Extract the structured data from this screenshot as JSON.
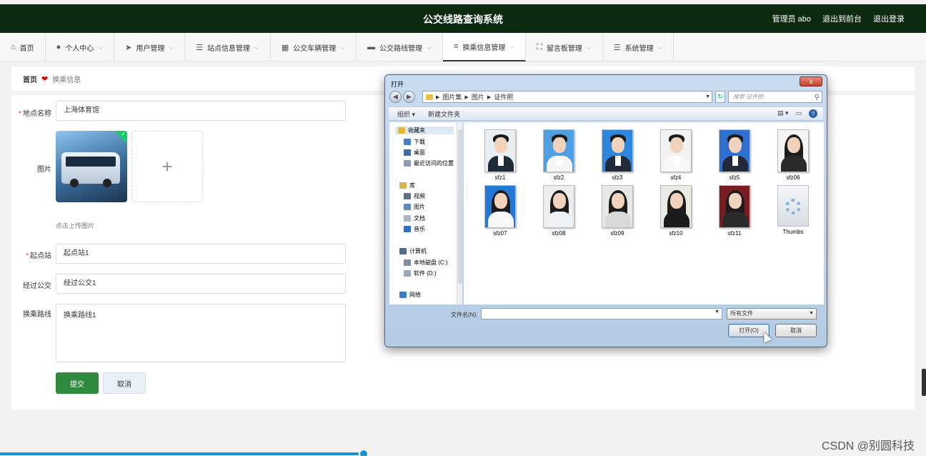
{
  "header": {
    "title": "公交线路查询系统",
    "user_label": "管理员 abo",
    "front_link": "退出到前台",
    "logout_link": "退出登录",
    "bg_color": "#0b2a10"
  },
  "nav": [
    {
      "label": "首页",
      "icon": "home-icon",
      "glyph": "⌂",
      "chev": ""
    },
    {
      "label": "个人中心",
      "icon": "user-icon",
      "glyph": "●",
      "chev": "⌵"
    },
    {
      "label": "用户管理",
      "icon": "send-icon",
      "glyph": "➤",
      "chev": "⌵"
    },
    {
      "label": "站点信息管理",
      "icon": "list-icon",
      "glyph": "☰",
      "chev": "⌵"
    },
    {
      "label": "公交车辆管理",
      "icon": "grid-icon",
      "glyph": "▦",
      "chev": "⌵"
    },
    {
      "label": "公交路线管理",
      "icon": "monitor-icon",
      "glyph": "▬",
      "chev": "⌵"
    },
    {
      "label": "换乘信息管理",
      "icon": "sliders-icon",
      "glyph": "≡",
      "chev": "⌵",
      "active": true
    },
    {
      "label": "留言板管理",
      "icon": "expand-icon",
      "glyph": "⛶",
      "chev": "⌵"
    },
    {
      "label": "系统管理",
      "icon": "menu-icon",
      "glyph": "☰",
      "chev": "⌵"
    }
  ],
  "breadcrumb": {
    "home": "首页",
    "current": "换乘信息"
  },
  "form": {
    "location_label": "地点名称",
    "location_value": "上海体育馆",
    "image_label": "图片",
    "upload_hint": "点击上传图片",
    "start_label": "起点站",
    "start_value": "起点站1",
    "bus_label": "经过公交",
    "bus_value": "经过公交1",
    "route_label": "换乘路线",
    "route_value": "换乘路线1",
    "submit": "提交",
    "cancel": "取消",
    "submit_color": "#2e8b3e"
  },
  "dialog": {
    "title": "打开",
    "close": "x",
    "path": [
      "图片集",
      "图片",
      "证件照"
    ],
    "search_placeholder": "搜索 证件照",
    "toolbar": {
      "organize": "组织 ▾",
      "new_folder": "新建文件夹"
    },
    "tree": [
      {
        "label": "收藏夹",
        "icon": "star-icon",
        "color": "#e8b839",
        "sub": false,
        "hl": true
      },
      {
        "label": "下载",
        "icon": "download-icon",
        "color": "#4a7fc1",
        "sub": true
      },
      {
        "label": "桌面",
        "icon": "desktop-icon",
        "color": "#3a6db0",
        "sub": true
      },
      {
        "label": "最近访问的位置",
        "icon": "recent-icon",
        "color": "#8a9db3",
        "sub": true
      },
      {
        "label": "库",
        "icon": "library-icon",
        "color": "#d8b24a",
        "sub": false
      },
      {
        "label": "视频",
        "icon": "video-icon",
        "color": "#5b6f86",
        "sub": true
      },
      {
        "label": "图片",
        "icon": "picture-icon",
        "color": "#5a8ac0",
        "sub": true
      },
      {
        "label": "文档",
        "icon": "document-icon",
        "color": "#a8b6c6",
        "sub": true
      },
      {
        "label": "音乐",
        "icon": "music-icon",
        "color": "#2f6fc4",
        "sub": true
      },
      {
        "label": "计算机",
        "icon": "computer-icon",
        "color": "#4f6c8e",
        "sub": false
      },
      {
        "label": "本地磁盘 (C:)",
        "icon": "disk-icon",
        "color": "#7d8fa3",
        "sub": true
      },
      {
        "label": "软件 (D:)",
        "icon": "disk-icon",
        "color": "#9aa8b8",
        "sub": true
      },
      {
        "label": "网络",
        "icon": "network-icon",
        "color": "#3a7cc9",
        "sub": false
      }
    ],
    "files": [
      {
        "name": "sfz1",
        "bg": "#e9eef2",
        "body": "#1f2a38",
        "female": false
      },
      {
        "name": "sfz2",
        "bg": "#4f9fe3",
        "body": "#f5f5f5",
        "female": false
      },
      {
        "name": "sfz3",
        "bg": "#2f86df",
        "body": "#222a3a",
        "female": false
      },
      {
        "name": "sfz4",
        "bg": "#f2f2f2",
        "body": "#f8f8f8",
        "female": false
      },
      {
        "name": "sfz5",
        "bg": "#2f6fd0",
        "body": "#20283a",
        "female": false
      },
      {
        "name": "sfz06",
        "bg": "#f4f4f4",
        "body": "#2a2a2a",
        "female": true
      },
      {
        "name": "sfz07",
        "bg": "#2378d8",
        "body": "#f8f8f8",
        "female": true
      },
      {
        "name": "sfz08",
        "bg": "#ededed",
        "body": "#eef2f7",
        "female": true
      },
      {
        "name": "sfz09",
        "bg": "#e8e8e8",
        "body": "#d9d9d9",
        "female": true
      },
      {
        "name": "sfz10",
        "bg": "#ebebe6",
        "body": "#1b1b1b",
        "female": true
      },
      {
        "name": "sfz11",
        "bg": "#7a1d22",
        "body": "#2b2b2b",
        "female": true
      }
    ],
    "thumbs_name": "Thumbs",
    "filename_label": "文件名(N):",
    "filename_value": "",
    "filter_value": "所有文件",
    "open_button": "打开(O)",
    "cancel_button": "取消"
  },
  "watermark": "CSDN @别圆科技"
}
